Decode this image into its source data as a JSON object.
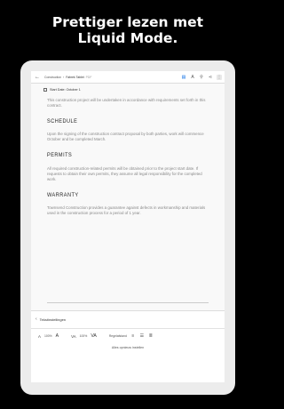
{
  "headline": {
    "line1": "Prettiger lezen met",
    "line2": "Liquid Mode."
  },
  "topbar": {
    "crumb1": "Construction",
    "sep": "›",
    "crumb2": "Fabrek Tablet",
    "filetype": "PDF",
    "icons": [
      "liquid-mode-icon",
      "text-size-icon",
      "search-icon",
      "share-icon",
      "more-icon"
    ]
  },
  "document": {
    "title": "Start Date: October 1",
    "intro": "This construction project will be undertaken in accordance with requirements set forth in this contract.",
    "sections": [
      {
        "heading": "SCHEDULE",
        "body": "Upon the signing of the construction contract proposal by both parties, work will commence October and be completed March."
      },
      {
        "heading": "PERMITS",
        "body": "All required construction-related permits will be obtained prior to the project start date. If requests to obtain their own permits, they assume all legal responsibility for the completed work."
      },
      {
        "heading": "WARRANTY",
        "body": "Townsend Construction provides a guarantee against defects in workmanship and materials used in the construction process for a period of 1 year."
      }
    ]
  },
  "panel": {
    "title": "Tekstinstellingen",
    "font_zoom": "100%",
    "letter_zoom": "100%",
    "line_spacing_label": "Regelafstand",
    "reset_label": "Alles opnieuw instellen"
  }
}
